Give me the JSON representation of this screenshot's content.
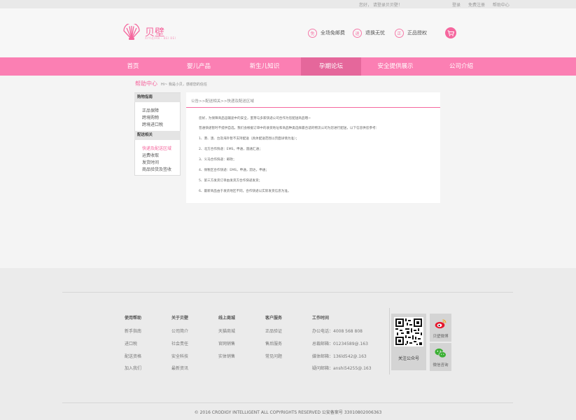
{
  "topbar": {
    "greeting": "您好， 请登录贝贝壁！",
    "links": [
      "登录",
      "免费注册",
      "帮助中心"
    ]
  },
  "logo": {
    "title": "贝壁",
    "subtitle": "XIYUJIAN · BEI BEI"
  },
  "features": [
    {
      "icon": "free-shipping-icon",
      "glyph": "免",
      "label": "全场免邮费"
    },
    {
      "icon": "return-icon",
      "glyph": "退",
      "label": "退换无忧"
    },
    {
      "icon": "authentic-icon",
      "glyph": "正",
      "label": "正品授权"
    }
  ],
  "nav": {
    "items": [
      {
        "label": "首页"
      },
      {
        "label": "婴儿产品"
      },
      {
        "label": "新生儿知识"
      },
      {
        "label": "孕期论坛"
      },
      {
        "label": "安全提供展示"
      },
      {
        "label": "公司介绍"
      }
    ]
  },
  "breadcrumb": {
    "title": "帮助中心",
    "sub": "Hi~ 我是小贝，感谢您的信任"
  },
  "sidebar": {
    "section1": {
      "title": "购物指南",
      "items": [
        "正品保障",
        "跨境购物",
        "跨境进口税"
      ]
    },
    "section2": {
      "title": "配送相关",
      "items": [
        "快递及配送区域",
        "运费收取",
        "发货时间",
        "商品验货及签收"
      ]
    }
  },
  "content": {
    "breadcrumb": "公告>>配送相关>>快递及配送区域",
    "paragraphs": [
      "您好，为保障商品运输途中的安全，蜜芽与多家快递公司合作为您配送商品哦~",
      "普通快递暂时不提供自选，我们会根据订单中的收货地址和商品种类选择最合适的物流公司为您进行配送，以下信息供您参考：",
      "1、港、澳、台及海外暂不支持配送（具体配送范围以页面详情为准）；",
      "2、北方合作快递：EMS，申通，圆通汇通；",
      "3、义马合作快递：邮政；",
      "4、保税区合作快递：EMS，申通，韵达，申通；",
      "5、第三方发货订单由发货方合作快递发货；",
      "6、最新商品由于发货地区不同，合作快递以实际发货信息为准。"
    ]
  },
  "footer": {
    "columns": [
      {
        "title": "使用帮助",
        "links": [
          "新手指南",
          "进口税",
          "配送资格",
          "加入我们"
        ]
      },
      {
        "title": "关于贝壁",
        "links": [
          "公司简介",
          "社会责任",
          "安全科技",
          "最新资讯"
        ]
      },
      {
        "title": "线上商城",
        "links": [
          "天猫商城",
          "官网销售",
          "实体销售"
        ]
      },
      {
        "title": "客户服务",
        "links": [
          "正品验证",
          "售后服务",
          "常见问题"
        ]
      },
      {
        "title": "工作时间",
        "links": [
          "办公电话：4008 568 808",
          "总裁邮箱：01234589@.163",
          "媒体邮箱：136ld542@.163",
          "疑问邮箱：anshi54255@.163"
        ]
      }
    ],
    "qr_label": "关注公众号",
    "social": [
      {
        "icon": "weibo-icon",
        "label": "贝壁微博"
      },
      {
        "icon": "wechat-icon",
        "label": "微信咨询"
      }
    ],
    "copyright": "©  2016  CRODIGY INTELLIGENT ALL COPYRIGHTS RESERVED    公安备案号 33010802006363"
  },
  "colors": {
    "brand_pink": "#f5679e",
    "nav_bg": "#fb7fb3",
    "nav_active": "#e5679b"
  }
}
